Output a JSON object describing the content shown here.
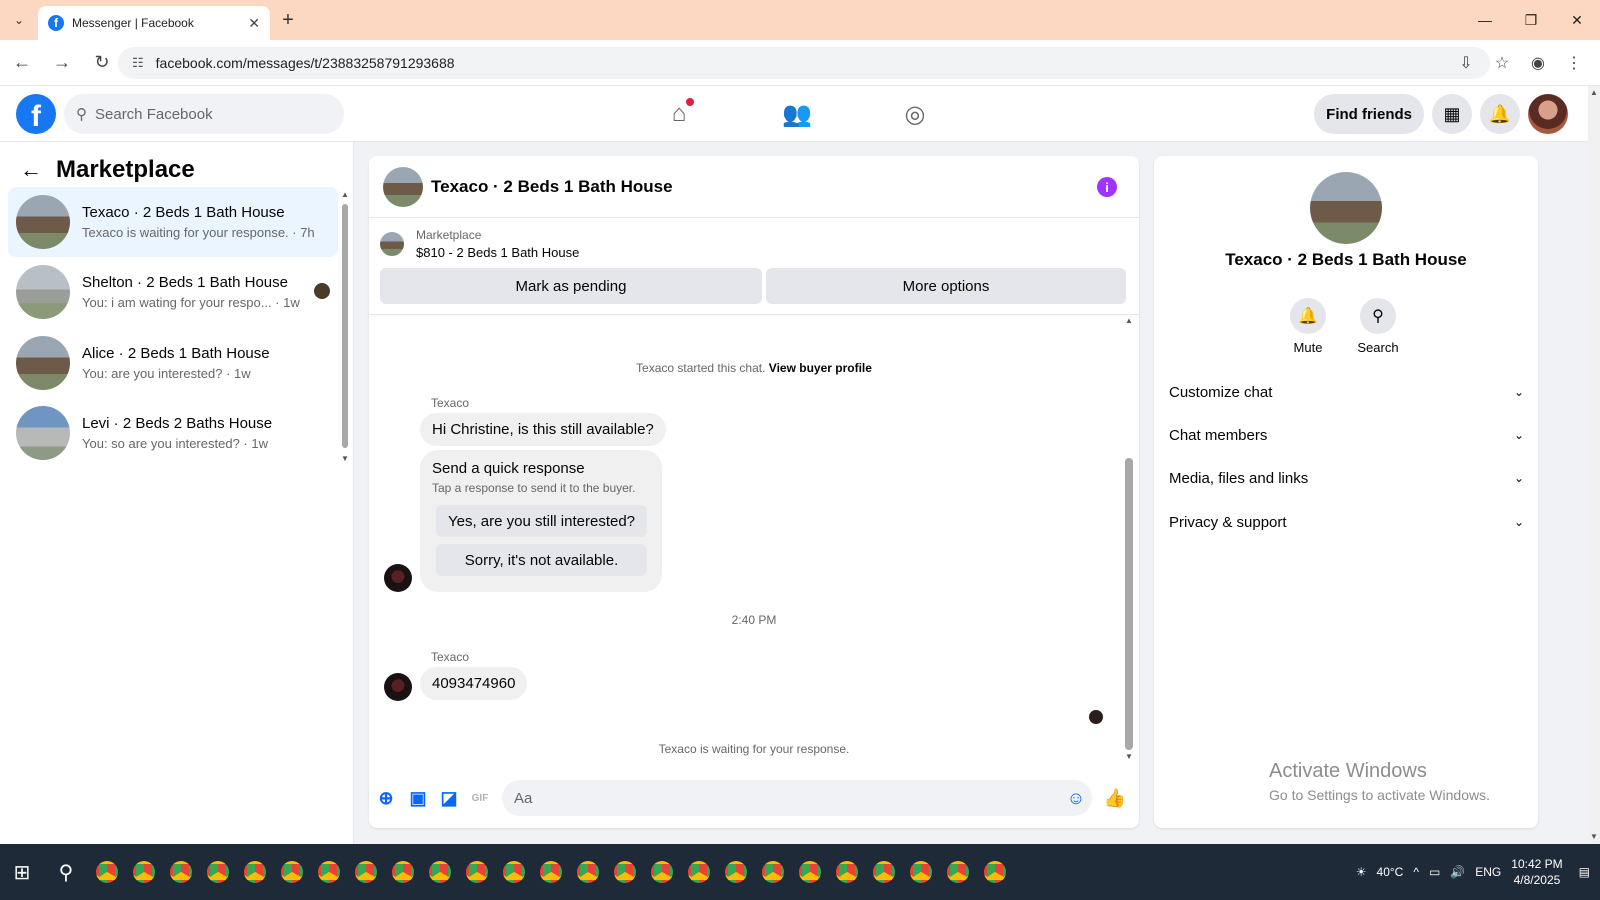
{
  "browser": {
    "tab_title": "Messenger | Facebook",
    "url": "facebook.com/messages/t/23883258791293688"
  },
  "header": {
    "search_placeholder": "Search Facebook",
    "find_friends": "Find friends"
  },
  "sidebar": {
    "title": "Marketplace",
    "conversations": [
      {
        "title": "Texaco · 2 Beds 1 Bath House",
        "preview": "Texaco is waiting for your response. · 7h"
      },
      {
        "title": "Shelton · 2 Beds 1 Bath House",
        "preview": "You: i am wating for your respo... · 1w"
      },
      {
        "title": "Alice · 2 Beds 1 Bath House",
        "preview": "You: are you interested? · 1w"
      },
      {
        "title": "Levi · 2 Beds 2 Baths House",
        "preview": "You: so are you interested? · 1w"
      }
    ]
  },
  "chat": {
    "title": "Texaco · 2 Beds 1 Bath House",
    "listing_label": "Marketplace",
    "listing_price": "$810 - 2 Beds 1 Bath House",
    "mark_pending": "Mark as pending",
    "more_options": "More options",
    "started_text": "Texaco started this chat.",
    "view_buyer": "View buyer profile",
    "sender_name": "Texaco",
    "message1": "Hi Christine, is this still available?",
    "quick_title": "Send a quick response",
    "quick_sub": "Tap a response to send it to the buyer.",
    "quick_opt1": "Yes, are you still interested?",
    "quick_opt2": "Sorry, it's not available.",
    "time": "2:40 PM",
    "message2": "4093474960",
    "waiting": "Texaco is waiting for your response.",
    "composer_placeholder": "Aa"
  },
  "details": {
    "title": "Texaco · 2 Beds 1 Bath House",
    "mute": "Mute",
    "search": "Search",
    "sections": [
      "Customize chat",
      "Chat members",
      "Media, files and links",
      "Privacy & support"
    ]
  },
  "watermark": {
    "line1": "Activate Windows",
    "line2": "Go to Settings to activate Windows."
  },
  "taskbar": {
    "weather": "40°C",
    "lang": "ENG",
    "time": "10:42 PM",
    "date": "4/8/2025"
  }
}
